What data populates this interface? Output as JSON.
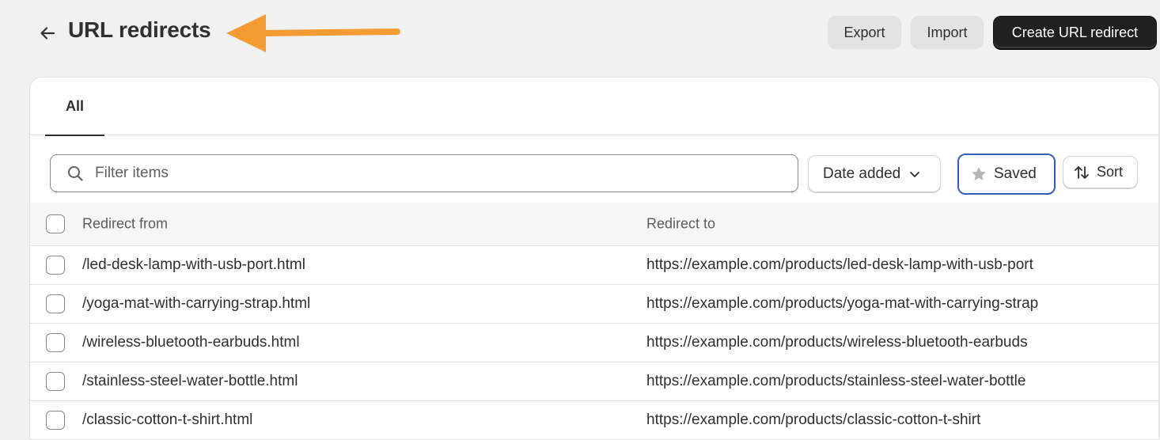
{
  "header": {
    "title": "URL redirects",
    "export_label": "Export",
    "import_label": "Import",
    "create_label": "Create URL redirect"
  },
  "annotation": {
    "arrow_color": "#f39c33"
  },
  "tabs": [
    {
      "label": "All"
    }
  ],
  "filters": {
    "search_placeholder": "Filter items",
    "date_label": "Date added",
    "saved_label": "Saved",
    "sort_label": "Sort"
  },
  "table": {
    "columns": [
      "Redirect from",
      "Redirect to"
    ],
    "rows": [
      {
        "from": "/led-desk-lamp-with-usb-port.html",
        "to": "https://example.com/products/led-desk-lamp-with-usb-port"
      },
      {
        "from": "/yoga-mat-with-carrying-strap.html",
        "to": "https://example.com/products/yoga-mat-with-carrying-strap"
      },
      {
        "from": "/wireless-bluetooth-earbuds.html",
        "to": "https://example.com/products/wireless-bluetooth-earbuds"
      },
      {
        "from": "/stainless-steel-water-bottle.html",
        "to": "https://example.com/products/stainless-steel-water-bottle"
      },
      {
        "from": "/classic-cotton-t-shirt.html",
        "to": "https://example.com/products/classic-cotton-t-shirt"
      }
    ]
  },
  "colors": {
    "background": "#f1f1f1",
    "primary_button": "#202020",
    "focus_ring": "#2f5fc2"
  },
  "icons": {
    "back": "arrow-left-icon",
    "search": "search-icon",
    "chevron": "chevron-down-icon",
    "star": "star-icon",
    "sort": "sort-arrows-icon"
  }
}
